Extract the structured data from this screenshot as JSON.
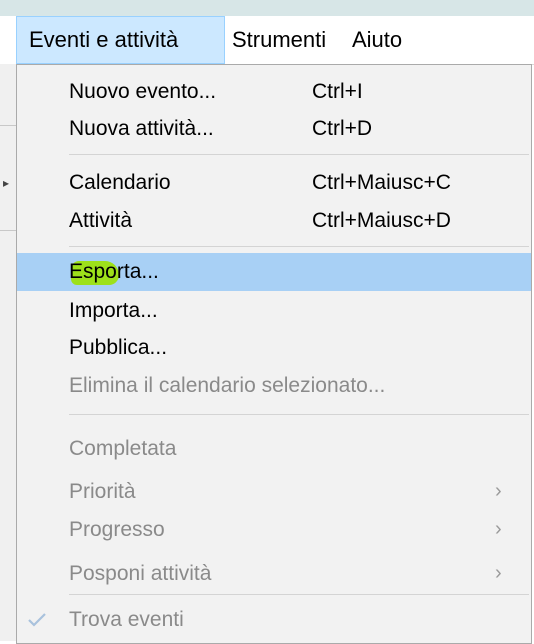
{
  "menubar": {
    "items": [
      {
        "label": "Eventi e attività",
        "active": true
      },
      {
        "label": "Strumenti",
        "active": false
      },
      {
        "label": "Aiuto",
        "active": false
      }
    ]
  },
  "menu": {
    "new_event": {
      "label": "Nuovo evento...",
      "shortcut": "Ctrl+I"
    },
    "new_task": {
      "label": "Nuova attività...",
      "shortcut": "Ctrl+D"
    },
    "calendar": {
      "label": "Calendario",
      "shortcut": "Ctrl+Maiusc+C"
    },
    "tasks": {
      "label": "Attività",
      "shortcut": "Ctrl+Maiusc+D"
    },
    "export": {
      "label": "Esporta...",
      "highlighted": true
    },
    "import": {
      "label": "Importa..."
    },
    "publish": {
      "label": "Pubblica..."
    },
    "delete_calendar": {
      "label": "Elimina il calendario selezionato...",
      "enabled": false
    },
    "completed": {
      "label": "Completata",
      "enabled": false
    },
    "priority": {
      "label": "Priorità",
      "enabled": false,
      "submenu_icon": "chevron-right-icon"
    },
    "progress": {
      "label": "Progresso",
      "enabled": false,
      "submenu_icon": "chevron-right-icon"
    },
    "postpone": {
      "label": "Posponi attività",
      "enabled": false,
      "submenu_icon": "chevron-right-icon"
    },
    "find_events": {
      "label": "Trova eventi",
      "enabled": false,
      "checked": true,
      "check_icon": "checkmark-icon"
    }
  },
  "colors": {
    "highlight": "#a8d0f5",
    "marker": "#9ce10f",
    "active_menubar": "#cce8ff",
    "disabled_text": "#8a8a8a"
  }
}
